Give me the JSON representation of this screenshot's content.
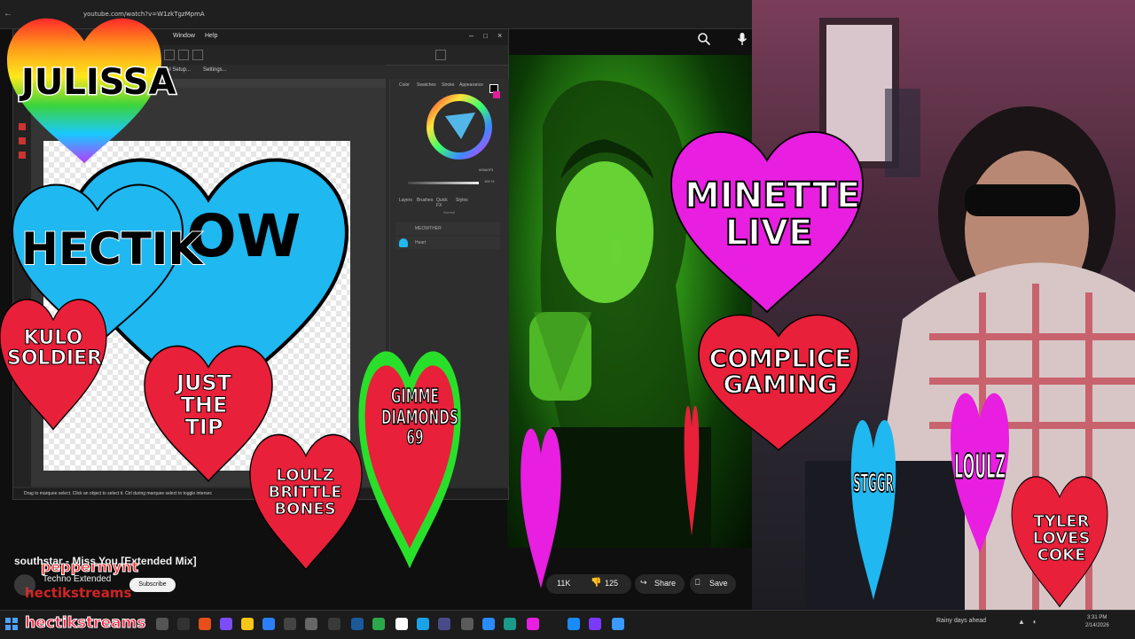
{
  "browser": {
    "url": "youtube.com/watch?v=W1zkTgzMpmA"
  },
  "editor": {
    "menu": [
      "Window",
      "Help"
    ],
    "context_buttons": [
      "...el Setup...",
      "Settings..."
    ],
    "panel_tabs": [
      "Color",
      "Swatches",
      "Stroke",
      "Appearance"
    ],
    "hex_value": "#06A0F3",
    "opacity_value": "100 %",
    "layers_tabs": [
      "Layers",
      "Brushes",
      "Quick FX",
      "Styles"
    ],
    "blend_mode": "Normal",
    "layers": [
      "MEOWTHER",
      "Heart"
    ],
    "status_text": "Drag to marquee select. Click an object to select it. Ctrl during marquee select to toggle intersec"
  },
  "video": {
    "title": "southstar - Miss You [Extended Mix]",
    "channel": "Techno Extended",
    "subscribe": "Subscribe",
    "likes": "11K",
    "dislikes": "125",
    "share": "Share",
    "save": "Save"
  },
  "overlay": {
    "julissa": "JULISSA",
    "hectik": "HECTIK",
    "meow_partial": "OW",
    "kulo": "KULO\nSOLDIER",
    "just_the_tip": "JUST\nTHE\nTIP",
    "loulz_brittle": "LOULZ\nBRITTLE\nBONES",
    "watermelon": "GIMME\nDIAMONDS\n69",
    "minette": "MINETTE\nLIVE",
    "complice": "COMPLICE\nGAMING",
    "loulz": "LOULZ",
    "tyler": "TYLER\nLOVES\nCOKE",
    "steggr": "STGGR",
    "peppermynt": "peppermynt",
    "hectikstreams_small": "hectikstreams",
    "hectikstreams_big": "hectikstreams"
  },
  "taskbar": {
    "weather": "Rainy days ahead",
    "time": "3:31 PM",
    "date": "2/14/2026"
  },
  "colors": {
    "heart_blue": "#1fb8f0",
    "heart_red": "#e8203a",
    "heart_magenta": "#e81ee0",
    "green_screen": "#2a8a14"
  }
}
